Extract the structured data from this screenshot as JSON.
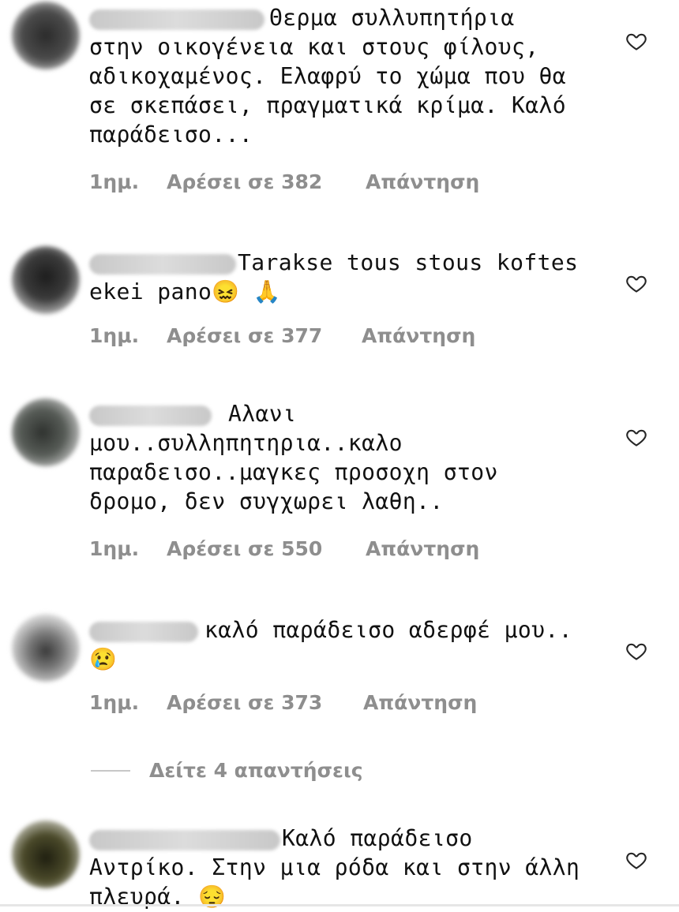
{
  "comments": [
    {
      "text": "Θερμα συλλυπητήρια\nστην οικογένεια και στους φίλους,\nαδικοχαμένος. Ελαφρύ το χώμα που θα\nσε σκεπάσει, πραγματικά κρίμα. Καλό\nπαράδεισο...",
      "time": "1ημ.",
      "likes": "Αρέσει σε 382",
      "reply": "Απάντηση"
    },
    {
      "text": "Tarakse tous stous koftes\nekei pano😖 🙏",
      "time": "1ημ.",
      "likes": "Αρέσει σε 377",
      "reply": "Απάντηση"
    },
    {
      "text": "Αλανι\nμου..συλληπητηρια..καλο\nπαραδεισο..μαγκες προσοχη στον\nδρομο, δεν συγχωρει λαθη..",
      "time": "1ημ.",
      "likes": "Αρέσει σε 550",
      "reply": "Απάντηση"
    },
    {
      "text": "καλό παράδεισο αδερφέ μου..\n😢",
      "time": "1ημ.",
      "likes": "Αρέσει σε 373",
      "reply": "Απάντηση"
    },
    {
      "text": "Καλό παράδεισο\nΑντρίκο. Στην μια ρόδα και στην άλλη\nπλευρά. 😔",
      "time": "",
      "likes": "",
      "reply": ""
    }
  ],
  "view_replies": "Δείτε 4 απαντήσεις",
  "colors": {
    "meta": "#8e8e8e",
    "text": "#111111",
    "heart": "#262626"
  },
  "icons": {
    "like": "heart-outline-icon"
  }
}
